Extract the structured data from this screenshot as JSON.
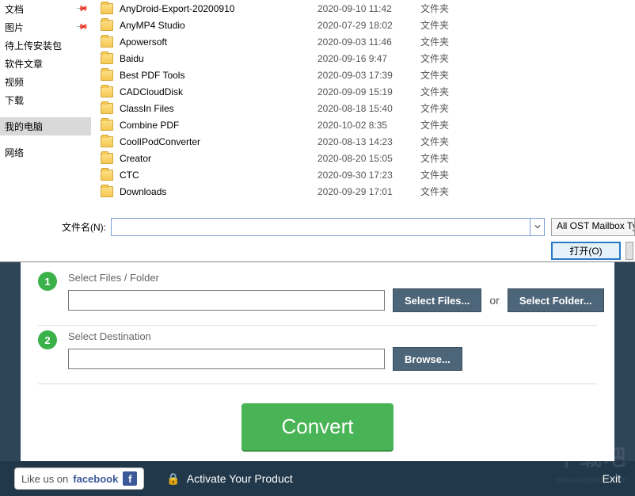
{
  "dialog": {
    "sidebar": [
      {
        "label": "文档",
        "pinned": true,
        "selected": false
      },
      {
        "label": "图片",
        "pinned": true,
        "selected": false
      },
      {
        "label": "待上传安装包",
        "pinned": false,
        "selected": false
      },
      {
        "label": "软件文章",
        "pinned": false,
        "selected": false
      },
      {
        "label": "视频",
        "pinned": false,
        "selected": false
      },
      {
        "label": "下载",
        "pinned": false,
        "selected": false
      },
      {
        "label": "我的电脑",
        "pinned": false,
        "selected": true
      },
      {
        "label": "网络",
        "pinned": false,
        "selected": false
      }
    ],
    "files": [
      {
        "name": "AnyDroid-Export-20200910",
        "date": "2020-09-10 11:42",
        "type": "文件夹"
      },
      {
        "name": "AnyMP4 Studio",
        "date": "2020-07-29 18:02",
        "type": "文件夹"
      },
      {
        "name": "Apowersoft",
        "date": "2020-09-03 11:46",
        "type": "文件夹"
      },
      {
        "name": "Baidu",
        "date": "2020-09-16 9:47",
        "type": "文件夹"
      },
      {
        "name": "Best PDF Tools",
        "date": "2020-09-03 17:39",
        "type": "文件夹"
      },
      {
        "name": "CADCloudDisk",
        "date": "2020-09-09 15:19",
        "type": "文件夹"
      },
      {
        "name": "ClassIn Files",
        "date": "2020-08-18 15:40",
        "type": "文件夹"
      },
      {
        "name": "Combine PDF",
        "date": "2020-10-02 8:35",
        "type": "文件夹"
      },
      {
        "name": "CoolIPodConverter",
        "date": "2020-08-13 14:23",
        "type": "文件夹"
      },
      {
        "name": "Creator",
        "date": "2020-08-20 15:05",
        "type": "文件夹"
      },
      {
        "name": "CTC",
        "date": "2020-09-30 17:23",
        "type": "文件夹"
      },
      {
        "name": "Downloads",
        "date": "2020-09-29 17:01",
        "type": "文件夹"
      }
    ],
    "filename_label": "文件名(N):",
    "filename_value": "",
    "filter_label": "All OST Mailbox Ty",
    "open_btn": "打开(O)"
  },
  "app": {
    "step1": {
      "num": "1",
      "label": "Select Files / Folder",
      "select_files_btn": "Select Files...",
      "or": "or",
      "select_folder_btn": "Select Folder..."
    },
    "step2": {
      "num": "2",
      "label": "Select Destination",
      "browse_btn": "Browse..."
    },
    "convert_btn": "Convert",
    "footer": {
      "like_pre": "Like us on",
      "fb_word": "facebook",
      "fb_f": "f",
      "activate": "Activate Your Product",
      "exit": "Exit"
    },
    "watermark": "下载吧",
    "watermark_sub": "www.xiazaiba.com"
  }
}
